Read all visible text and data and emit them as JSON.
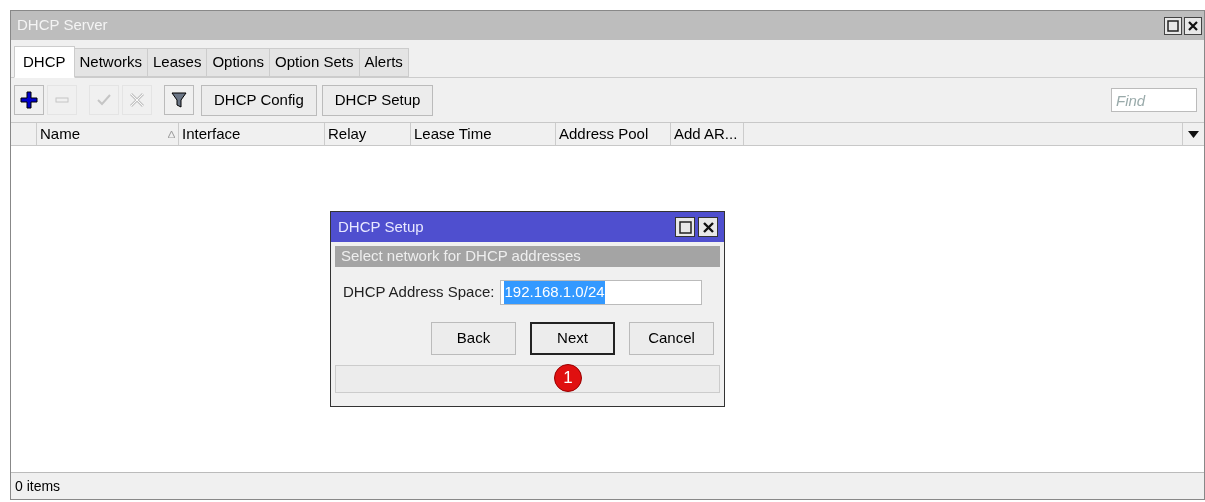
{
  "window": {
    "title": "DHCP Server"
  },
  "tabs": [
    {
      "label": "DHCP",
      "selected": true
    },
    {
      "label": "Networks",
      "selected": false
    },
    {
      "label": "Leases",
      "selected": false
    },
    {
      "label": "Options",
      "selected": false
    },
    {
      "label": "Option Sets",
      "selected": false
    },
    {
      "label": "Alerts",
      "selected": false
    }
  ],
  "toolbar": {
    "icon_buttons": [
      {
        "kind": "add",
        "disabled": false
      },
      {
        "kind": "remove",
        "disabled": true
      },
      {
        "kind": "enable",
        "disabled": true
      },
      {
        "kind": "disable",
        "disabled": true
      },
      {
        "kind": "filter",
        "disabled": false
      }
    ],
    "buttons": [
      "DHCP Config",
      "DHCP Setup"
    ],
    "find": {
      "placeholder": "Find"
    }
  },
  "table": {
    "columns": [
      {
        "label": "Name",
        "sorted": true
      },
      {
        "label": "Interface",
        "sorted": false
      },
      {
        "label": "Relay",
        "sorted": false
      },
      {
        "label": "Lease Time",
        "sorted": false
      },
      {
        "label": "Address Pool",
        "sorted": false
      },
      {
        "label": "Add AR...",
        "sorted": false
      }
    ]
  },
  "status_bar": "0 items",
  "dialog": {
    "title": "DHCP Setup",
    "step": "Select network for DHCP addresses",
    "field_label": "DHCP Address Space:",
    "field_value": "192.168.1.0/24",
    "value_selected": true,
    "buttons": [
      {
        "label": "Back",
        "default": false
      },
      {
        "label": "Next",
        "default": true
      },
      {
        "label": "Cancel",
        "default": false
      }
    ],
    "callout": "1"
  }
}
